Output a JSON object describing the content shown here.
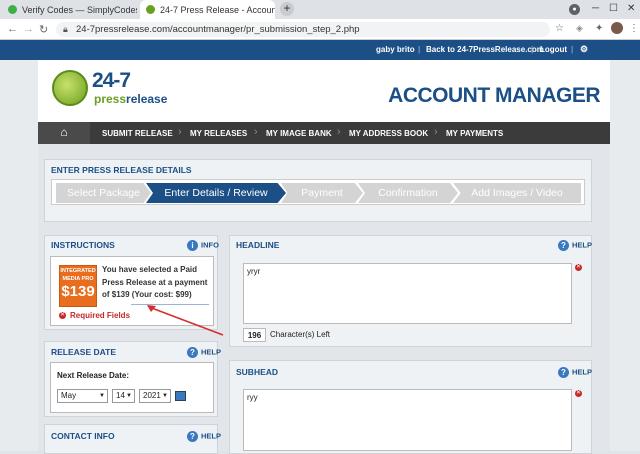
{
  "browser": {
    "tabs": [
      {
        "title": "Verify Codes — SimplyCodes"
      },
      {
        "title": "24-7 Press Release - Account Ma"
      }
    ],
    "url": "24-7pressrelease.com/accountmanager/pr_submission_step_2.php"
  },
  "topbar": {
    "user": "gaby brito",
    "back_link": "Back to 24-7PressRelease.com",
    "logout": "Logout"
  },
  "header": {
    "logo_247": "24-7",
    "logo_press": "press",
    "logo_release": "release",
    "title": "ACCOUNT MANAGER"
  },
  "nav": {
    "items": [
      "SUBMIT RELEASE",
      "MY RELEASES",
      "MY IMAGE BANK",
      "MY ADDRESS BOOK",
      "MY PAYMENTS"
    ]
  },
  "details": {
    "title": "ENTER PRESS RELEASE DETAILS",
    "steps": [
      "Select Package",
      "Enter Details / Review",
      "Payment",
      "Confirmation",
      "Add Images / Video"
    ],
    "active_step": 1
  },
  "instructions": {
    "title": "INSTRUCTIONS",
    "info": "INFO",
    "badge_line1": "INTEGRATED",
    "badge_line2": "MEDIA PRO",
    "badge_price": "$139",
    "text": "You have selected a Paid Press Release at a payment of $139 (Your cost: $99)",
    "required": "Required Fields"
  },
  "release_date": {
    "title": "RELEASE DATE",
    "help": "HELP",
    "label": "Next Release Date:",
    "month": "May",
    "day": "14",
    "year": "2021"
  },
  "contact": {
    "title": "CONTACT INFO",
    "help": "HELP"
  },
  "headline": {
    "title": "HEADLINE",
    "help": "HELP",
    "value": "yryr",
    "chars_left": "196",
    "chars_label": "Character(s) Left"
  },
  "subhead": {
    "title": "SUBHEAD",
    "help": "HELP",
    "value": "ryy"
  },
  "colors": {
    "brand_blue": "#1b4f86",
    "accent_orange": "#e86d1f",
    "logo_green": "#6aa021",
    "error_red": "#c62828"
  }
}
